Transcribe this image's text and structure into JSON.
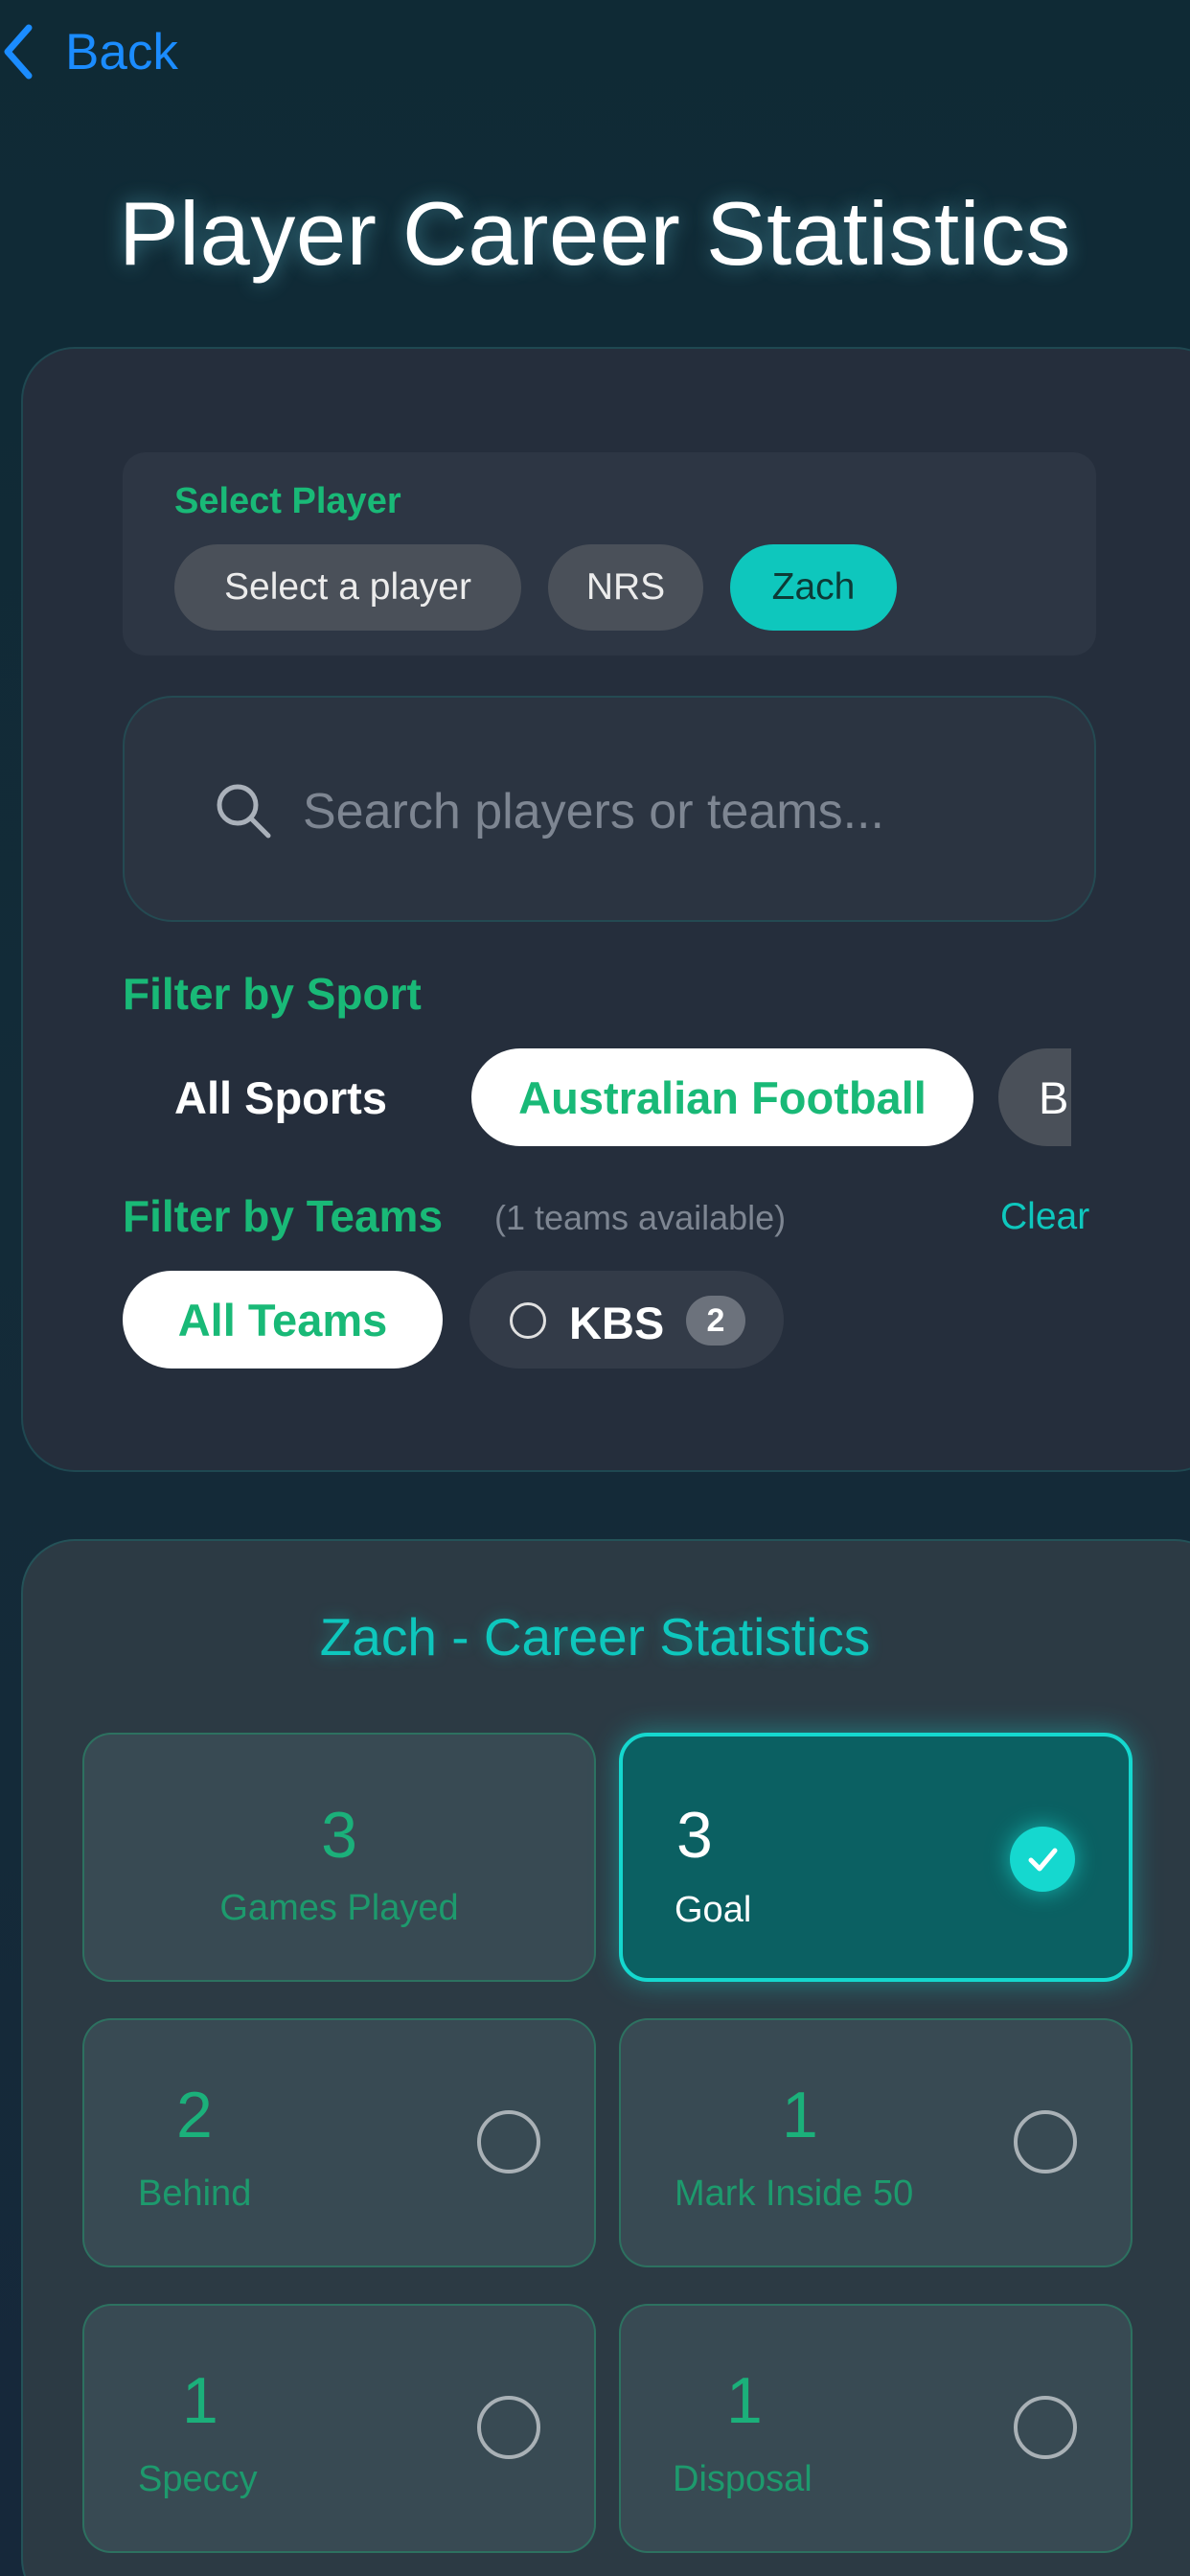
{
  "nav": {
    "back_label": "Back"
  },
  "title": "Player Career Statistics",
  "select_player": {
    "label": "Select Player",
    "options": [
      {
        "label": "Select a player",
        "selected": false
      },
      {
        "label": "NRS",
        "selected": false
      },
      {
        "label": "Zach",
        "selected": true
      }
    ]
  },
  "search": {
    "placeholder": "Search players or teams..."
  },
  "sport_filter": {
    "label": "Filter by Sport",
    "options": [
      {
        "label": "All Sports",
        "selected": false
      },
      {
        "label": "Australian Football",
        "selected": true
      },
      {
        "label": "B",
        "selected": false
      }
    ]
  },
  "team_filter": {
    "label": "Filter by Teams",
    "available_text": "(1 teams available)",
    "clear_label": "Clear",
    "all_label": "All Teams",
    "teams": [
      {
        "name": "KBS",
        "count": "2",
        "selected": false
      }
    ]
  },
  "stats": {
    "title": "Zach - Career Statistics",
    "tiles": [
      {
        "value": "3",
        "label": "Games Played",
        "selected": false
      },
      {
        "value": "3",
        "label": "Goal",
        "selected": true
      },
      {
        "value": "2",
        "label": "Behind",
        "selected": false
      },
      {
        "value": "1",
        "label": "Mark Inside 50",
        "selected": false
      },
      {
        "value": "1",
        "label": "Speccy",
        "selected": false
      },
      {
        "value": "1",
        "label": "Disposal",
        "selected": false
      }
    ]
  },
  "colors": {
    "accent_teal": "#0ec7bd",
    "accent_green": "#19b977",
    "back_blue": "#1b8cff"
  }
}
